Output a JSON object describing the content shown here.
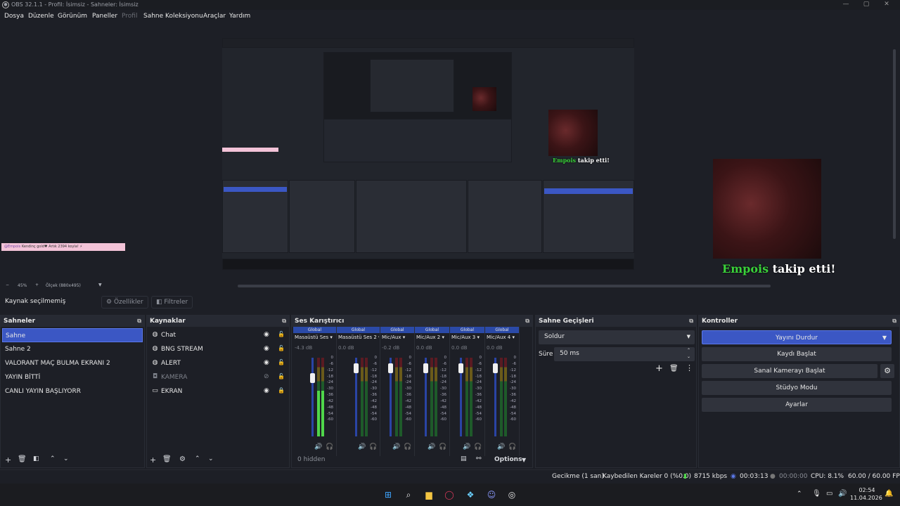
{
  "window": {
    "title": "OBS 32.1.1 - Profil: İsimsiz - Sahneler: İsimsiz",
    "minimize": "—",
    "maximize": "▢",
    "close": "✕"
  },
  "menu": [
    "Dosya",
    "Düzenle",
    "Görünüm",
    "Paneller",
    "Profil",
    "Sahne Koleksiyonu",
    "Araçlar",
    "Yardım"
  ],
  "preview": {
    "follow_name": "Empois",
    "follow_rest": " takip etti!",
    "chat_name": "@Empois",
    "chat_text": "Kendinç gold♥ Artık 2394 koyla! ⚡",
    "zoom_label": "45%",
    "zoom_minus": "−",
    "zoom_plus": "+",
    "scale_label": "Ölçek (880x495)"
  },
  "sourcebar": {
    "status": "Kaynak seçilmemiş",
    "properties": "Özellikler",
    "filters": "Filtreler"
  },
  "scenes": {
    "title": "Sahneler",
    "items": [
      "Sahne",
      "Sahne 2",
      "VALORANT MAÇ BULMA EKRANI 2",
      "YAYIN BİTTİ",
      "CANLI YAYIN BAŞLIYORR"
    ],
    "selected_index": 0
  },
  "sources": {
    "title": "Kaynaklar",
    "items": [
      {
        "name": "Chat",
        "icon": "globe-icon",
        "visible": true,
        "locked": false
      },
      {
        "name": "BNG STREAM",
        "icon": "globe-icon",
        "visible": true,
        "locked": false
      },
      {
        "name": "ALERT",
        "icon": "globe-icon",
        "visible": true,
        "locked": false
      },
      {
        "name": "KAMERA",
        "icon": "camera-icon",
        "visible": false,
        "locked": false
      },
      {
        "name": "EKRAN",
        "icon": "monitor-icon",
        "visible": true,
        "locked": true
      }
    ]
  },
  "mixer": {
    "title": "Ses Karıştırıcı",
    "scale": [
      "0",
      "-6",
      "-12",
      "-18",
      "-24",
      "-30",
      "-36",
      "-42",
      "-48",
      "-54",
      "-60"
    ],
    "channels": [
      {
        "label": "Global",
        "name": "Masaüstü Ses",
        "db": "-4.3 dB",
        "level": 0.58,
        "fader": 0.78
      },
      {
        "label": "Global",
        "name": "Masaüstü Ses 2",
        "db": "0.0 dB",
        "level": 0.0,
        "fader": 0.92
      },
      {
        "label": "Global",
        "name": "Mic/Aux",
        "db": "-0.2 dB",
        "level": 0.0,
        "fader": 0.92
      },
      {
        "label": "Global",
        "name": "Mic/Aux 2",
        "db": "0.0 dB",
        "level": 0.0,
        "fader": 0.92
      },
      {
        "label": "Global",
        "name": "Mic/Aux 3",
        "db": "0.0 dB",
        "level": 0.0,
        "fader": 0.92
      },
      {
        "label": "Global",
        "name": "Mic/Aux 4",
        "db": "0.0 dB",
        "level": 0.0,
        "fader": 0.92
      }
    ],
    "hidden": "0 hidden",
    "options": "Options"
  },
  "transitions": {
    "title": "Sahne Geçişleri",
    "transition": "Soldur",
    "duration_label": "Süre",
    "duration": "50 ms"
  },
  "controls": {
    "title": "Kontroller",
    "stop_stream": "Yayını Durdur",
    "start_record": "Kaydı Başlat",
    "virtual_cam": "Sanal Kamerayı Başlat",
    "studio_mode": "Stüdyo Modu",
    "settings": "Ayarlar"
  },
  "status": {
    "delay": "Gecikme (1 san)",
    "dropped": "Kaybedilen Kareler 0 (%0.0)",
    "bitrate": "8715 kbps",
    "stream_time": "00:03:13",
    "record_time": "00:00:00",
    "cpu": "CPU: 8.1%",
    "fps": "60.00 / 60.00 FPS"
  },
  "taskbar": {
    "time": "02:54",
    "date": "11.04.2026"
  },
  "colors": {
    "accent": "#3b57c4",
    "follow_name": "#3ad13a",
    "meter_green": "#4fd64a"
  }
}
